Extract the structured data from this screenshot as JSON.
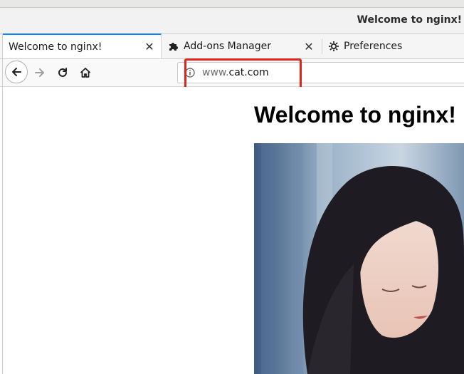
{
  "window": {
    "title": "Welcome to nginx!"
  },
  "tabs": [
    {
      "label": "Welcome to nginx!",
      "active": true,
      "closable": true
    },
    {
      "label": "Add-ons Manager",
      "icon": "puzzle-icon",
      "active": false,
      "closable": true
    },
    {
      "label": "Preferences",
      "icon": "gear-icon",
      "active": false,
      "closable": false
    }
  ],
  "navigation": {
    "url_prefix": "www.",
    "url_domain": "cat.com",
    "buttons": [
      "back-icon",
      "forward-icon",
      "reload-icon",
      "home-icon"
    ]
  },
  "page": {
    "heading": "Welcome to nginx!",
    "image_alt": "photo"
  },
  "colors": {
    "annotation": "#e1251b",
    "active_tab_accent": "#0a84ff"
  }
}
